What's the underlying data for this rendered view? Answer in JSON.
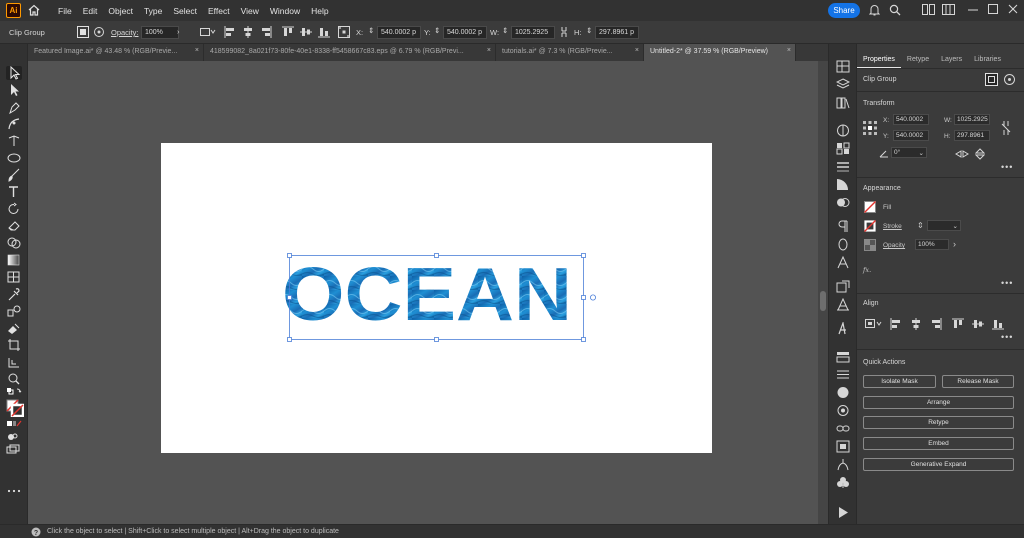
{
  "app": {
    "logo_text": "Ai"
  },
  "menu": [
    "File",
    "Edit",
    "Object",
    "Type",
    "Select",
    "Effect",
    "View",
    "Window",
    "Help"
  ],
  "share_label": "Share",
  "control": {
    "selection_type": "Clip Group",
    "opacity_label": "Opacity:",
    "opacity_value": "100%",
    "x_label": "X:",
    "x_value": "540.0002 p",
    "y_label": "Y:",
    "y_value": "540.0002 p",
    "w_label": "W:",
    "w_value": "1025.2925",
    "h_label": "H:",
    "h_value": "297.8961 p"
  },
  "tabs": [
    {
      "label": "Featured Image.ai* @ 43.48 % (RGB/Previe...",
      "active": false
    },
    {
      "label": "418599082_8a021f73-80fe-40e1-8338-ff5458667c83.eps @ 6.79 % (RGB/Previ...",
      "active": false
    },
    {
      "label": "tutorials.ai* @ 7.3 % (RGB/Previe...",
      "active": false
    },
    {
      "label": "Untitled-2* @ 37.59 % (RGB/Preview)",
      "active": true
    }
  ],
  "tab_close_glyph": "×",
  "canvas": {
    "text": "OCEAN"
  },
  "panel": {
    "tabs": [
      "Properties",
      "Retype",
      "Layers",
      "Libraries"
    ],
    "selection_type": "Clip Group",
    "transform_title": "Transform",
    "x_label": "X:",
    "x_value": "540.0002",
    "y_label": "Y:",
    "y_value": "540.0002",
    "w_label": "W:",
    "w_value": "1025.2925",
    "h_label": "H:",
    "h_value": "297.8961",
    "angle_value": "0°",
    "appearance_title": "Appearance",
    "fill_label": "Fill",
    "stroke_label": "Stroke",
    "opacity_label": "Opacity",
    "opacity_value": "100%",
    "fx_label": "fx.",
    "align_title": "Align",
    "quick_actions_title": "Quick Actions",
    "isolate_mask": "Isolate Mask",
    "release_mask": "Release Mask",
    "arrange": "Arrange",
    "retype": "Retype",
    "embed": "Embed",
    "generative_expand": "Generative Expand",
    "more": "•••"
  },
  "status": {
    "text": "Click the object to select  |  Shift+Click to select multiple object  |  Alt+Drag the object to duplicate"
  },
  "colors": {
    "accent": "#1473e6",
    "ocean": "#1a7bc4",
    "chrome": "#323232"
  }
}
